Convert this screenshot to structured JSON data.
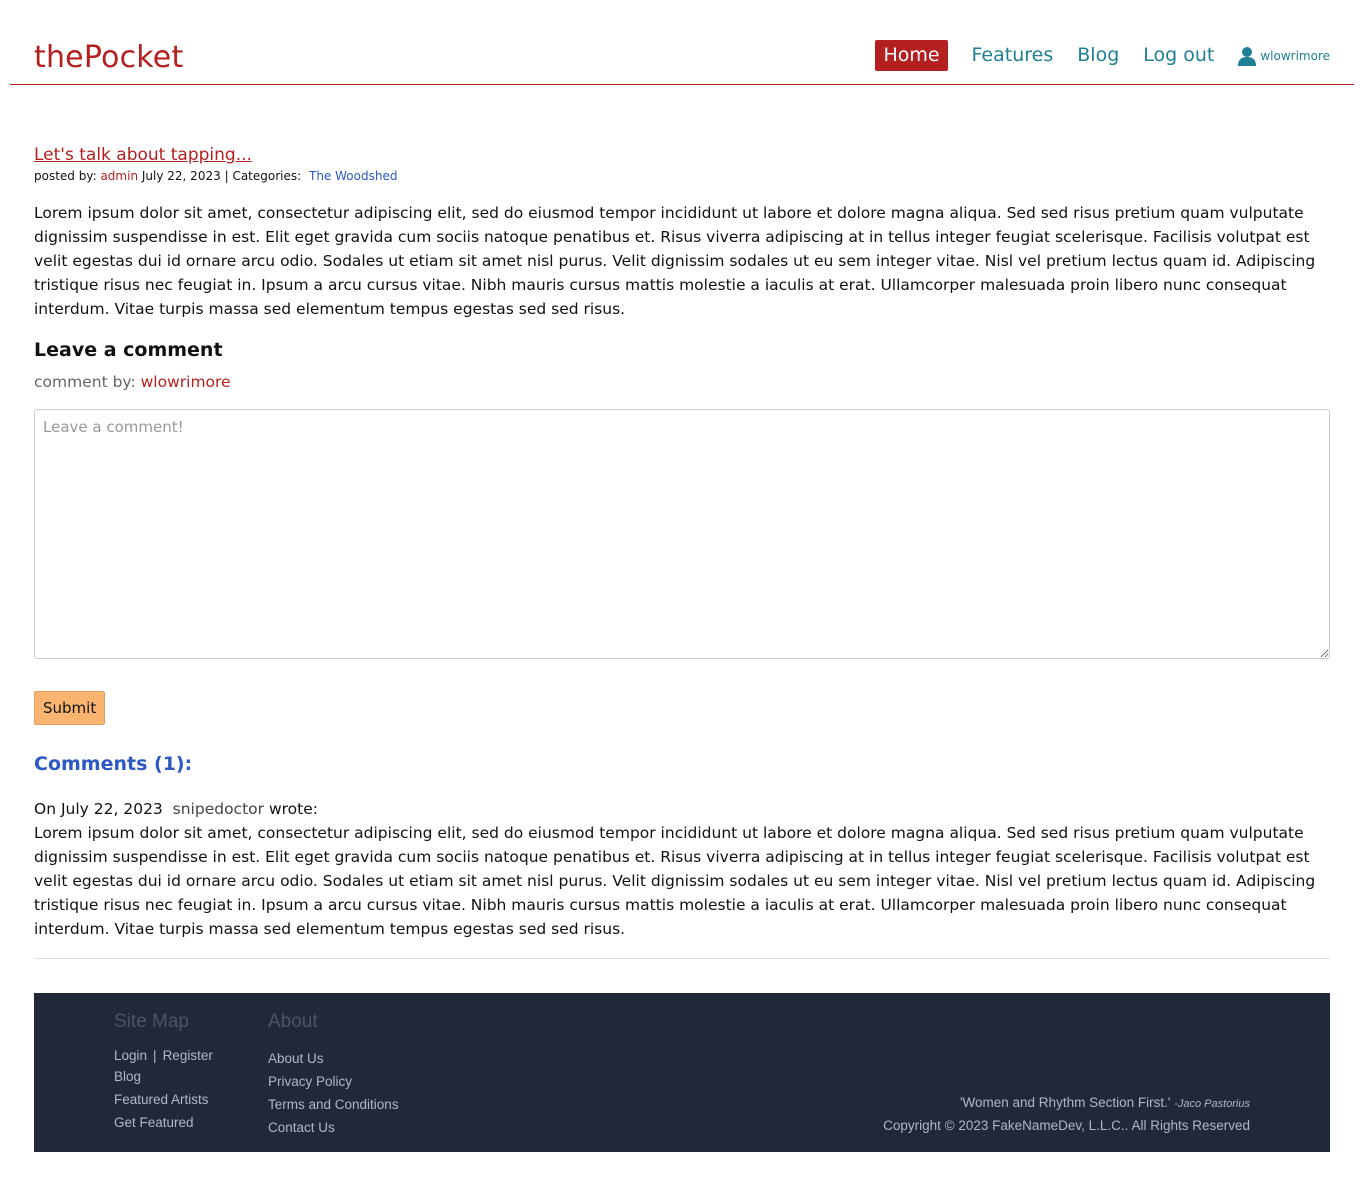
{
  "header": {
    "brand": "thePocket",
    "nav": [
      {
        "label": "Home",
        "active": true
      },
      {
        "label": "Features",
        "active": false
      },
      {
        "label": "Blog",
        "active": false
      },
      {
        "label": "Log out",
        "active": false
      }
    ],
    "user": {
      "icon": "user-icon",
      "name": "wlowrimore"
    }
  },
  "post": {
    "title": "Let's talk about tapping...",
    "posted_by_label": "posted by:",
    "author": "admin",
    "date": "July 22, 2023",
    "separator": "|",
    "categories_label": "Categories:",
    "category": "The Woodshed",
    "body": "Lorem ipsum dolor sit amet, consectetur adipiscing elit, sed do eiusmod tempor incididunt ut labore et dolore magna aliqua. Sed sed risus pretium quam vulputate dignissim suspendisse in est. Elit eget gravida cum sociis natoque penatibus et. Risus viverra adipiscing at in tellus integer feugiat scelerisque. Facilisis volutpat est velit egestas dui id ornare arcu odio. Sodales ut etiam sit amet nisl purus. Velit dignissim sodales ut eu sem integer vitae. Nisl vel pretium lectus quam id. Adipiscing tristique risus nec feugiat in. Ipsum a arcu cursus vitae. Nibh mauris cursus mattis molestie a iaculis at erat. Ullamcorper malesuada proin libero nunc consequat interdum. Vitae turpis massa sed elementum tempus egestas sed sed risus."
  },
  "comment_form": {
    "heading": "Leave a comment",
    "comment_by_label": "comment by:",
    "commenter": "wlowrimore",
    "placeholder": "Leave a comment!",
    "value": "",
    "submit_label": "Submit"
  },
  "comments": {
    "heading": "Comments (1):",
    "items": [
      {
        "prefix": "On",
        "date": "July 22, 2023",
        "user": "snipedoctor",
        "suffix": "wrote:",
        "body": "Lorem ipsum dolor sit amet, consectetur adipiscing elit, sed do eiusmod tempor incididunt ut labore et dolore magna aliqua. Sed sed risus pretium quam vulputate dignissim suspendisse in est. Elit eget gravida cum sociis natoque penatibus et. Risus viverra adipiscing at in tellus integer feugiat scelerisque. Facilisis volutpat est velit egestas dui id ornare arcu odio. Sodales ut etiam sit amet nisl purus. Velit dignissim sodales ut eu sem integer vitae. Nisl vel pretium lectus quam id. Adipiscing tristique risus nec feugiat in. Ipsum a arcu cursus vitae. Nibh mauris cursus mattis molestie a iaculis at erat. Ullamcorper malesuada proin libero nunc consequat interdum. Vitae turpis massa sed elementum tempus egestas sed sed risus."
      }
    ]
  },
  "footer": {
    "sitemap": {
      "heading": "Site Map",
      "login": "Login",
      "sep": "|",
      "register": "Register",
      "links": [
        "Blog",
        "Featured Artists",
        "Get Featured"
      ]
    },
    "about": {
      "heading": "About",
      "links": [
        "About Us",
        "Privacy Policy",
        "Terms and Conditions",
        "Contact Us"
      ]
    },
    "quote": "'Women and Rhythm Section First.'",
    "quote_author": "-Jaco Pastorius",
    "copyright": "Copyright © 2023 FakeNameDev, L.L.C.. All Rights Reserved"
  },
  "colors": {
    "brand_red": "#b41f1f",
    "nav_teal": "#1f7f95",
    "link_blue": "#2c59c4",
    "submit_orange": "#f9b570",
    "footer_bg": "#212938"
  }
}
